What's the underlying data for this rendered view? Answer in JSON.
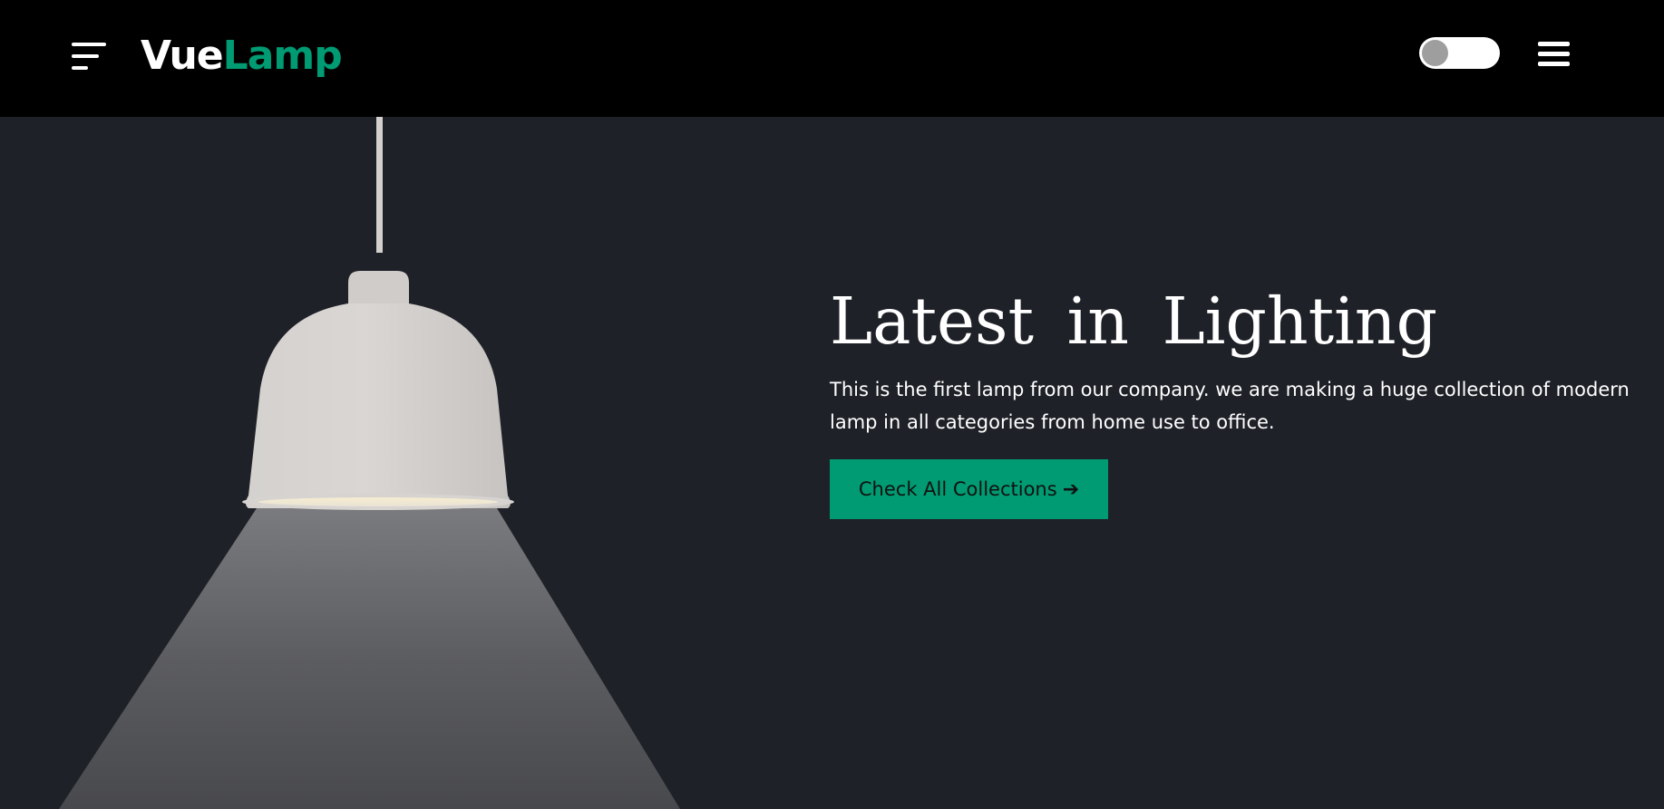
{
  "header": {
    "brand": {
      "part1": "Vue",
      "part2": "Lamp",
      "part1_color": "#ffffff",
      "part2_color": "#009b72"
    },
    "left_menu_icon": "menu-lines-icon",
    "theme_toggle": {
      "state": "off",
      "knob_color": "#9e9e9e"
    },
    "right_menu_icon": "hamburger-icon",
    "background": "#000000"
  },
  "hero": {
    "background": "#1f2128",
    "title": "Latest  in  Lighting",
    "description": "This is the first lamp from our company. we are making a huge collection of modern lamp in all categories from home use to office.",
    "cta": {
      "label": "Check All Collections",
      "icon": "arrow-right-icon",
      "arrow_glyph": "➔",
      "color": "#009b72"
    },
    "image": "pendant-lamp-illustration"
  }
}
